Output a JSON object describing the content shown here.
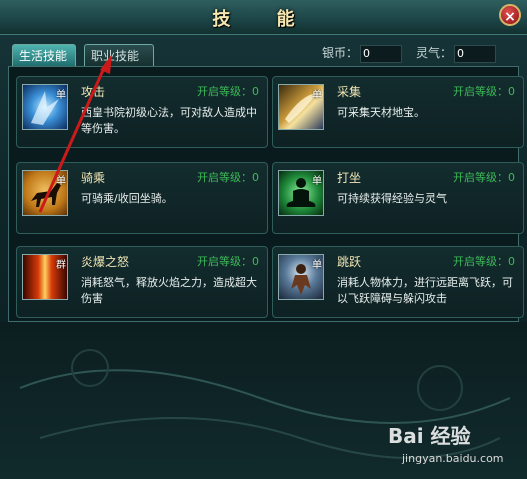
{
  "window": {
    "title": "技 能",
    "close_icon": "×"
  },
  "tabs": [
    {
      "label": "生活技能",
      "active": true
    },
    {
      "label": "职业技能",
      "active": false
    }
  ],
  "currency": {
    "silver_label": "银币：",
    "silver_value": "0",
    "spirit_label": "灵气：",
    "spirit_value": "0"
  },
  "skills": [
    {
      "name": "攻击",
      "badge": "单",
      "level_text": "开启等级：0",
      "desc": "西皇书院初级心法，可对敌人造成中等伤害。"
    },
    {
      "name": "采集",
      "badge": "单",
      "level_text": "开启等级：0",
      "desc": "可采集天材地宝。"
    },
    {
      "name": "骑乘",
      "badge": "单",
      "level_text": "开启等级：0",
      "desc": "可骑乘/收回坐骑。"
    },
    {
      "name": "打坐",
      "badge": "单",
      "level_text": "开启等级：0",
      "desc": "可持续获得经验与灵气"
    },
    {
      "name": "炎爆之怒",
      "badge": "群",
      "level_text": "开启等级：0",
      "desc": "消耗怒气，释放火焰之力，造成超大伤害"
    },
    {
      "name": "跳跃",
      "badge": "单",
      "level_text": "开启等级：0",
      "desc": "消耗人物体力，进行远距离飞跃，可以飞跃障碍与躲闪攻击"
    }
  ],
  "watermark": {
    "logo": "Bai 经验",
    "url": "jingyan.baidu.com"
  }
}
